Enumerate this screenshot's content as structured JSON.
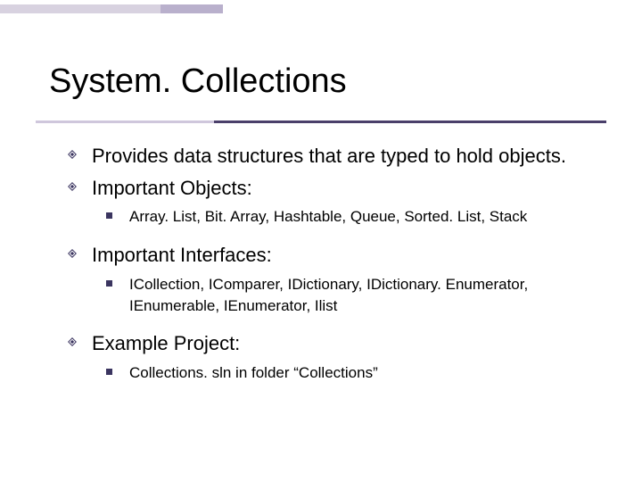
{
  "title": "System. Collections",
  "items": [
    {
      "text": "Provides data structures that are typed to hold objects.",
      "sub": []
    },
    {
      "text": "Important Objects:",
      "sub": [
        "Array. List, Bit. Array, Hashtable, Queue, Sorted. List, Stack"
      ]
    },
    {
      "text": "Important Interfaces:",
      "sub": [
        "ICollection, IComparer, IDictionary, IDictionary. Enumerator, IEnumerable, IEnumerator, Ilist"
      ]
    },
    {
      "text": "Example Project:",
      "sub": [
        "Collections. sln in folder “Collections”"
      ]
    }
  ]
}
